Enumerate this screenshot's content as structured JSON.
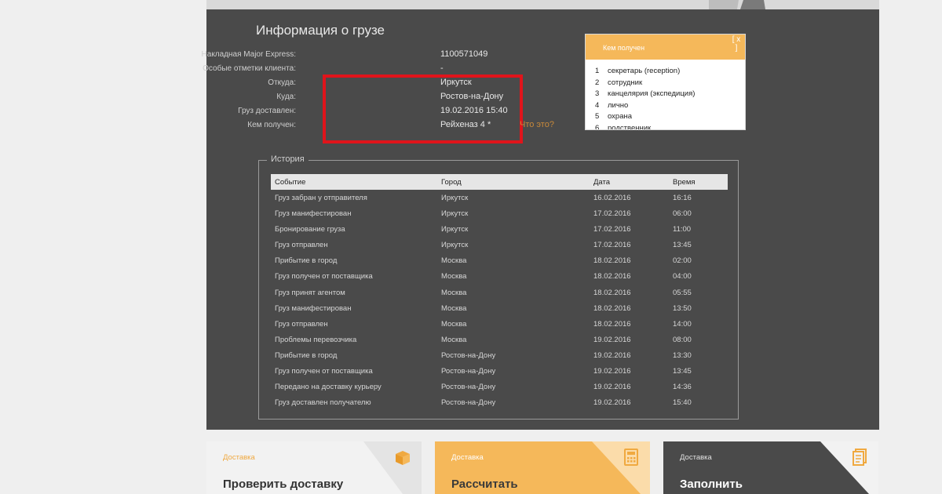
{
  "title": "Информация о грузе",
  "info": [
    {
      "label": "Накладная Major Express:",
      "value": "1100571049"
    },
    {
      "label": "Особые отметки клиента:",
      "value": "-"
    },
    {
      "label": "Откуда:",
      "value": "Иркутск"
    },
    {
      "label": "Куда:",
      "value": "Ростов-на-Дону"
    },
    {
      "label": "Груз доставлен:",
      "value": "19.02.2016 15:40"
    },
    {
      "label": "Кем получен:",
      "value": "Рейхеназ 4  *"
    }
  ],
  "what_link": "Что это?",
  "popup": {
    "title": "Кем получен",
    "close": "[ x ]",
    "items": [
      {
        "n": "1",
        "text": "секретарь (reception)"
      },
      {
        "n": "2",
        "text": "сотрудник"
      },
      {
        "n": "3",
        "text": "канцелярия (экспедиция)"
      },
      {
        "n": "4",
        "text": "лично"
      },
      {
        "n": "5",
        "text": "охрана"
      },
      {
        "n": "6",
        "text": "родственник"
      }
    ]
  },
  "history": {
    "legend": "История",
    "columns": [
      "Событие",
      "Город",
      "Дата",
      "Время"
    ],
    "rows": [
      [
        "Груз забран у отправителя",
        "Иркутск",
        "16.02.2016",
        "16:16"
      ],
      [
        "Груз манифестирован",
        "Иркутск",
        "17.02.2016",
        "06:00"
      ],
      [
        "Бронирование груза",
        "Иркутск",
        "17.02.2016",
        "11:00"
      ],
      [
        "Груз отправлен",
        "Иркутск",
        "17.02.2016",
        "13:45"
      ],
      [
        "Прибытие в город",
        "Москва",
        "18.02.2016",
        "02:00"
      ],
      [
        "Груз получен от поставщика",
        "Москва",
        "18.02.2016",
        "04:00"
      ],
      [
        "Груз принят агентом",
        "Москва",
        "18.02.2016",
        "05:55"
      ],
      [
        "Груз манифестирован",
        "Москва",
        "18.02.2016",
        "13:50"
      ],
      [
        "Груз отправлен",
        "Москва",
        "18.02.2016",
        "14:00"
      ],
      [
        "Проблемы перевозчика",
        "Москва",
        "19.02.2016",
        "08:00"
      ],
      [
        "Прибытие в город",
        "Ростов-на-Дону",
        "19.02.2016",
        "13:30"
      ],
      [
        "Груз получен от поставщика",
        "Ростов-на-Дону",
        "19.02.2016",
        "13:45"
      ],
      [
        "Передано на доставку курьеру",
        "Ростов-на-Дону",
        "19.02.2016",
        "14:36"
      ],
      [
        "Груз доставлен получателю",
        "Ростов-на-Дону",
        "19.02.2016",
        "15:40"
      ]
    ]
  },
  "cards": [
    {
      "label": "Доставка",
      "title": "Проверить доставку",
      "icon": "box-icon",
      "bg": "#f2f2f2",
      "fg": "#333333",
      "labelColor": "#f0a940"
    },
    {
      "label": "Доставка",
      "title": "Рассчитать",
      "icon": "calculator-icon",
      "bg": "#f5b85a",
      "fg": "#3a3a3a",
      "labelColor": "#ffffff"
    },
    {
      "label": "Доставка",
      "title": "Заполнить",
      "icon": "document-icon",
      "bg": "#4a4a4a",
      "fg": "#ffffff",
      "labelColor": "#e0e0e0"
    }
  ],
  "colors": {
    "panel": "#4a4a4a",
    "accent": "#f5b85a",
    "highlight": "#e0141b"
  }
}
